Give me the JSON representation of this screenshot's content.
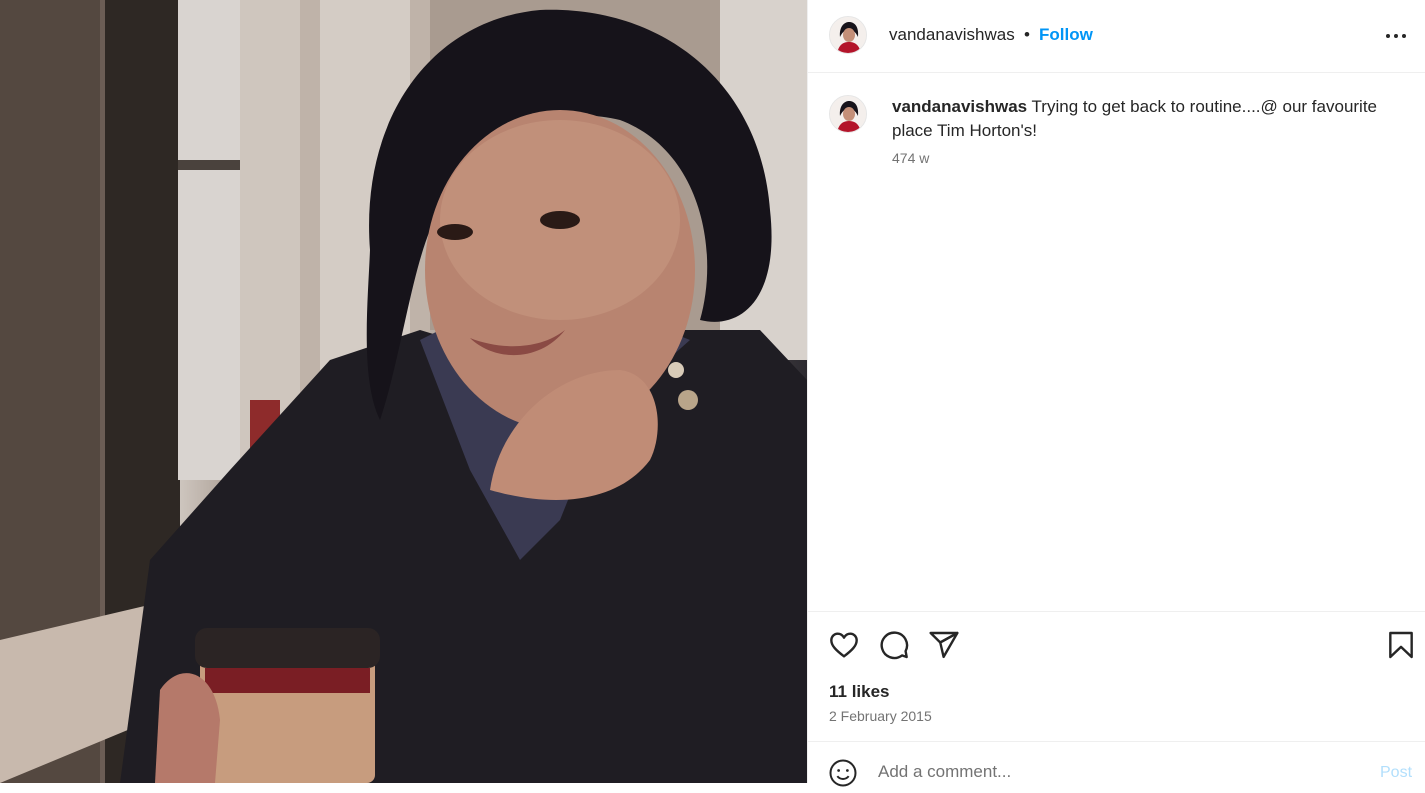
{
  "post": {
    "photo_alt": "Photo by vandanavishwas"
  },
  "header": {
    "username": "vandanavishwas",
    "separator": "•",
    "follow_label": "Follow",
    "more_icon": "more-horizontal-icon"
  },
  "caption": {
    "username": "vandanavishwas",
    "text": "Trying to get back to routine....@ our favourite place Tim Horton's!",
    "age": "474 w"
  },
  "actions": {
    "like_icon": "heart-icon",
    "comment_icon": "comment-icon",
    "share_icon": "send-icon",
    "save_icon": "bookmark-icon",
    "likes": "11 likes",
    "date": "2 February 2015"
  },
  "comment": {
    "emoji_icon": "emoji-icon",
    "placeholder": "Add a comment...",
    "post_label": "Post"
  },
  "colors": {
    "accent": "#0095f6",
    "post_disabled": "#b2dffc",
    "text": "#262626",
    "muted": "#737373"
  }
}
